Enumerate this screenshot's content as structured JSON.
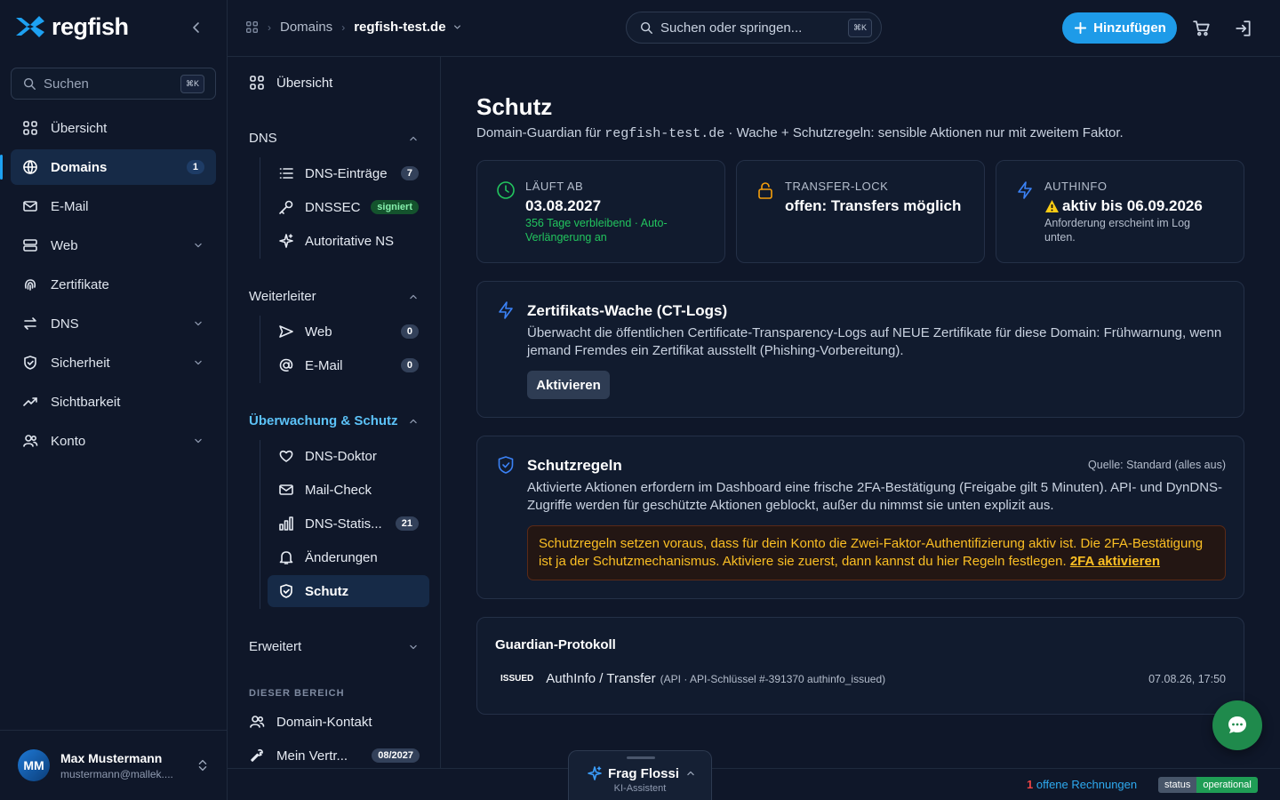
{
  "app": {
    "logo_text": "regfish"
  },
  "sidebar": {
    "search_label": "Suchen",
    "search_kbd": "⌘K",
    "items": [
      {
        "label": "Übersicht",
        "icon": "grid-icon"
      },
      {
        "label": "Domains",
        "icon": "globe-icon",
        "count": "1",
        "active": true
      },
      {
        "label": "E-Mail",
        "icon": "mail-icon"
      },
      {
        "label": "Web",
        "icon": "server-icon",
        "expandable": true
      },
      {
        "label": "Zertifikate",
        "icon": "fingerprint-icon"
      },
      {
        "label": "DNS",
        "icon": "arrows-icon",
        "expandable": true
      },
      {
        "label": "Sicherheit",
        "icon": "shield-icon",
        "expandable": true
      },
      {
        "label": "Sichtbarkeit",
        "icon": "trend-icon"
      },
      {
        "label": "Konto",
        "icon": "users-icon",
        "expandable": true
      }
    ],
    "user": {
      "initials": "MM",
      "name": "Max Mustermann",
      "email": "mustermann@mallek...."
    }
  },
  "topbar": {
    "breadcrumb": {
      "section": "Domains",
      "current": "regfish-test.de"
    },
    "search_placeholder": "Suchen oder springen...",
    "search_kbd": "⌘K",
    "add_label": "Hinzufügen"
  },
  "subnav": {
    "overview": "Übersicht",
    "dns": {
      "title": "DNS",
      "items": [
        {
          "label": "DNS-Einträge",
          "badge": "7"
        },
        {
          "label": "DNSSEC",
          "badge": "signiert"
        },
        {
          "label": "Autoritative NS"
        }
      ]
    },
    "forwarders": {
      "title": "Weiterleiter",
      "items": [
        {
          "label": "Web",
          "badge": "0"
        },
        {
          "label": "E-Mail",
          "badge": "0"
        }
      ]
    },
    "monitoring": {
      "title": "Überwachung & Schutz",
      "items": [
        {
          "label": "DNS-Doktor"
        },
        {
          "label": "Mail-Check"
        },
        {
          "label": "DNS-Statis...",
          "badge": "21"
        },
        {
          "label": "Änderungen"
        },
        {
          "label": "Schutz",
          "active": true
        }
      ]
    },
    "advanced": "Erweitert",
    "section_label": "DIESER BEREICH",
    "contact": "Domain-Kontakt",
    "contract": {
      "label": "Mein Vertr...",
      "badge": "08/2027"
    }
  },
  "main": {
    "title": "Schutz",
    "subtitle_pre": "Domain-Guardian für ",
    "subtitle_domain": "regfish-test.de",
    "subtitle_post": " · Wache + Schutzregeln: sensible Aktionen nur mit zweitem Faktor.",
    "stats": [
      {
        "key": "LÄUFT AB",
        "value": "03.08.2027",
        "note": "356 Tage verbleibend · Auto-Verlängerung an",
        "icon": "clock-icon",
        "accent": "#22c55e"
      },
      {
        "key": "TRANSFER-LOCK",
        "value": "offen: Transfers möglich",
        "icon": "lock-icon",
        "accent": "#f59e0b"
      },
      {
        "key": "AUTHINFO",
        "value": "aktiv bis 06.09.2026",
        "note": "Anforderung erscheint im Log unten.",
        "icon": "bolt-icon",
        "accent": "#3b82f6"
      }
    ],
    "ct_watch": {
      "title": "Zertifikats-Wache (CT-Logs)",
      "text": "Überwacht die öffentlichen Certificate-Transparency-Logs auf NEUE Zertifikate für diese Domain: Frühwarnung, wenn jemand Fremdes ein Zertifikat ausstellt (Phishing-Vorbereitung).",
      "button": "Aktivieren"
    },
    "rules": {
      "title": "Schutzregeln",
      "source": "Quelle: Standard (alles aus)",
      "text": "Aktivierte Aktionen erfordern im Dashboard eine frische 2FA-Bestätigung (Freigabe gilt 5 Minuten). API- und DynDNS-Zugriffe werden für geschützte Aktionen geblockt, außer du nimmst sie unten explizit aus.",
      "warning": "Schutzregeln setzen voraus, dass für dein Konto die Zwei-Faktor-Authentifizierung aktiv ist. Die 2FA-Bestätigung ist ja der Schutzmechanismus. Aktiviere sie zuerst, dann kannst du hier Regeln festlegen.",
      "warning_link": "2FA aktivieren"
    },
    "log": {
      "title": "Guardian-Protokoll",
      "entries": [
        {
          "tag": "ISSUED",
          "text": "AuthInfo / Transfer",
          "meta": "(API · API-Schlüssel #-391370 authinfo_issued)",
          "time": "07.08.26, 17:50"
        }
      ]
    }
  },
  "footer": {
    "invoice_count": "1",
    "invoice_text": "offene Rechnungen",
    "status_label": "status",
    "status_value": "operational",
    "assistant_title": "Frag Flossi",
    "assistant_sub": "KI-Assistent"
  }
}
